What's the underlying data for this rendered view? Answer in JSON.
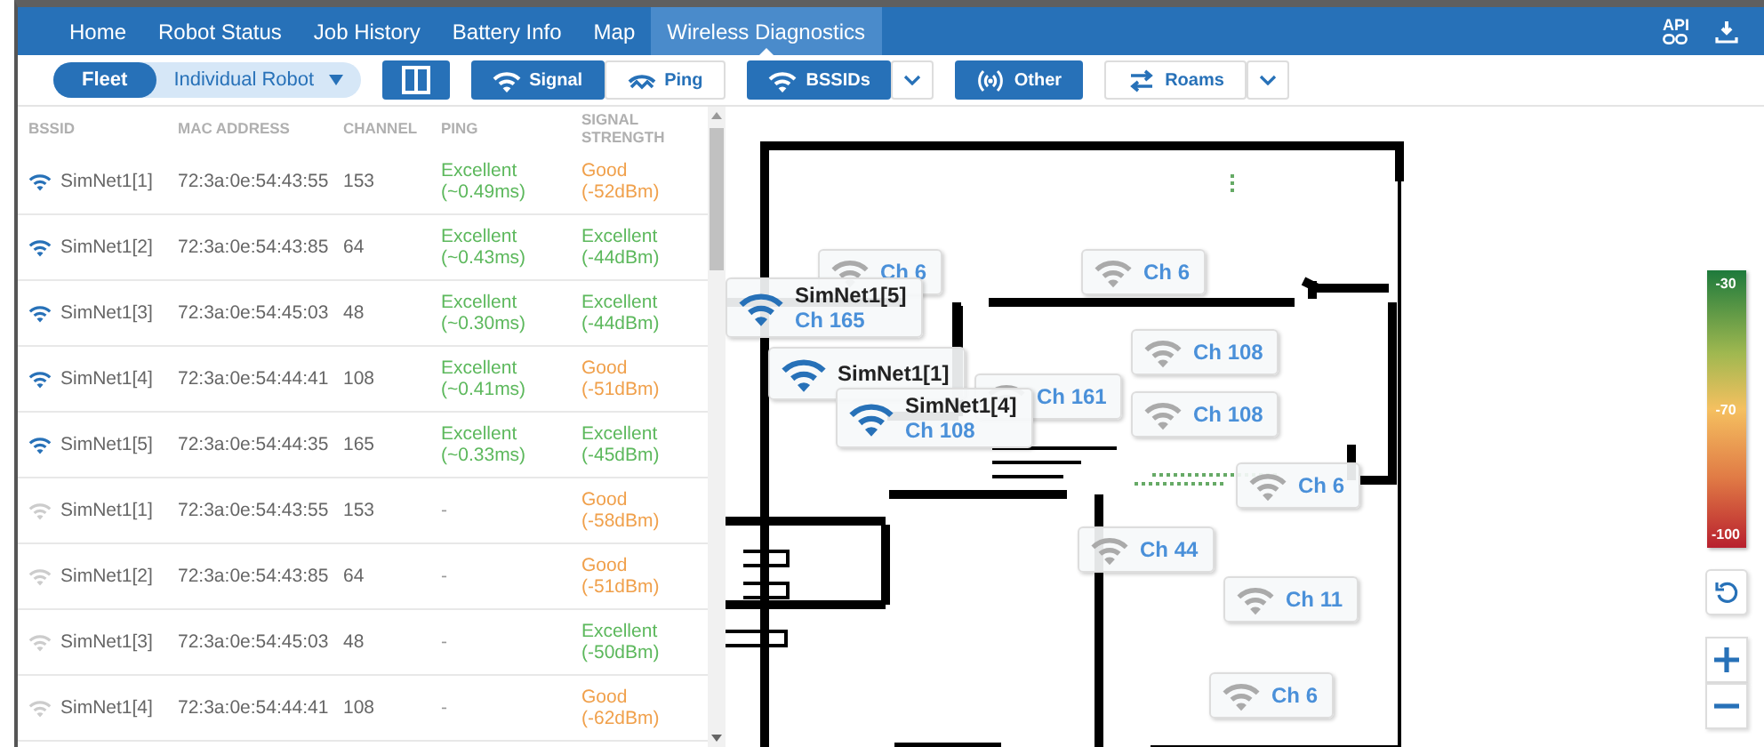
{
  "nav": {
    "tabs": [
      {
        "label": "Home",
        "selected": false
      },
      {
        "label": "Robot Status",
        "selected": false
      },
      {
        "label": "Job History",
        "selected": false
      },
      {
        "label": "Battery Info",
        "selected": false
      },
      {
        "label": "Map",
        "selected": false
      },
      {
        "label": "Wireless Diagnostics",
        "selected": true
      }
    ],
    "api_label": "API"
  },
  "toolbar": {
    "scope": [
      {
        "label": "Fleet",
        "selected": true
      },
      {
        "label": "Individual Robot",
        "selected": false
      }
    ],
    "metric": [
      {
        "label": "Signal",
        "selected": true
      },
      {
        "label": "Ping",
        "selected": false
      }
    ],
    "filters": [
      {
        "label": "BSSIDs",
        "selected": true,
        "dropdown": true
      },
      {
        "label": "Other",
        "selected": true,
        "dropdown": false
      },
      {
        "label": "Roams",
        "selected": false,
        "dropdown": true
      }
    ]
  },
  "table": {
    "columns": [
      "BSSID",
      "MAC ADDRESS",
      "CHANNEL",
      "PING",
      "SIGNAL STRENGTH"
    ],
    "rows": [
      {
        "active": true,
        "bssid": "SimNet1[1]",
        "mac": "72:3a:0e:54:43:55",
        "channel": "153",
        "ping": {
          "kind": "excellent",
          "text": "Excellent",
          "value": "(~0.49ms)"
        },
        "signal": {
          "kind": "good",
          "text": "Good",
          "value": "(-52dBm)"
        }
      },
      {
        "active": true,
        "bssid": "SimNet1[2]",
        "mac": "72:3a:0e:54:43:85",
        "channel": "64",
        "ping": {
          "kind": "excellent",
          "text": "Excellent",
          "value": "(~0.43ms)"
        },
        "signal": {
          "kind": "excellent",
          "text": "Excellent",
          "value": "(-44dBm)"
        }
      },
      {
        "active": true,
        "bssid": "SimNet1[3]",
        "mac": "72:3a:0e:54:45:03",
        "channel": "48",
        "ping": {
          "kind": "excellent",
          "text": "Excellent",
          "value": "(~0.30ms)"
        },
        "signal": {
          "kind": "excellent",
          "text": "Excellent",
          "value": "(-44dBm)"
        }
      },
      {
        "active": true,
        "bssid": "SimNet1[4]",
        "mac": "72:3a:0e:54:44:41",
        "channel": "108",
        "ping": {
          "kind": "excellent",
          "text": "Excellent",
          "value": "(~0.41ms)"
        },
        "signal": {
          "kind": "good",
          "text": "Good",
          "value": "(-51dBm)"
        }
      },
      {
        "active": true,
        "bssid": "SimNet1[5]",
        "mac": "72:3a:0e:54:44:35",
        "channel": "165",
        "ping": {
          "kind": "excellent",
          "text": "Excellent",
          "value": "(~0.33ms)"
        },
        "signal": {
          "kind": "excellent",
          "text": "Excellent",
          "value": "(-45dBm)"
        }
      },
      {
        "active": false,
        "bssid": "SimNet1[1]",
        "mac": "72:3a:0e:54:43:55",
        "channel": "153",
        "ping": {
          "kind": "none",
          "text": "-"
        },
        "signal": {
          "kind": "good",
          "text": "Good",
          "value": "(-58dBm)"
        }
      },
      {
        "active": false,
        "bssid": "SimNet1[2]",
        "mac": "72:3a:0e:54:43:85",
        "channel": "64",
        "ping": {
          "kind": "none",
          "text": "-"
        },
        "signal": {
          "kind": "good",
          "text": "Good",
          "value": "(-51dBm)"
        }
      },
      {
        "active": false,
        "bssid": "SimNet1[3]",
        "mac": "72:3a:0e:54:45:03",
        "channel": "48",
        "ping": {
          "kind": "none",
          "text": "-"
        },
        "signal": {
          "kind": "excellent",
          "text": "Excellent",
          "value": "(-50dBm)"
        }
      },
      {
        "active": false,
        "bssid": "SimNet1[4]",
        "mac": "72:3a:0e:54:44:41",
        "channel": "108",
        "ping": {
          "kind": "none",
          "text": "-"
        },
        "signal": {
          "kind": "good",
          "text": "Good",
          "value": "(-62dBm)"
        }
      }
    ]
  },
  "map": {
    "markers": [
      {
        "kind": "other",
        "channel": "Ch 6"
      },
      {
        "kind": "other",
        "channel": "Ch 6"
      },
      {
        "kind": "other",
        "channel": "Ch 161"
      },
      {
        "kind": "other",
        "channel": "Ch 108"
      },
      {
        "kind": "other",
        "channel": "Ch 108"
      },
      {
        "kind": "active",
        "name": "SimNet1[5]",
        "channel": "Ch 165"
      },
      {
        "kind": "active",
        "name": "SimNet1[1]"
      },
      {
        "kind": "active",
        "name": "SimNet1[4]",
        "channel": "Ch 108"
      },
      {
        "kind": "other",
        "channel": "Ch 6"
      },
      {
        "kind": "other",
        "channel": "Ch 44"
      },
      {
        "kind": "other",
        "channel": "Ch 11"
      },
      {
        "kind": "other",
        "channel": "Ch 6"
      }
    ],
    "legend": {
      "labels": [
        "-30",
        "-70",
        "-100"
      ]
    }
  }
}
